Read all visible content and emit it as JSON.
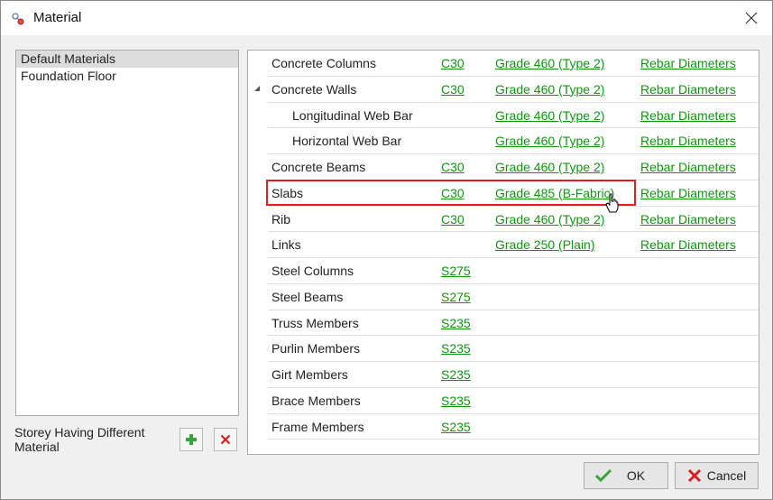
{
  "window": {
    "title": "Material",
    "icon": "material-app-icon",
    "close_icon": "close-icon"
  },
  "storeys": {
    "items": [
      {
        "label": "Default Materials",
        "selected": true
      },
      {
        "label": "Foundation Floor",
        "selected": false
      }
    ],
    "different_label": "Storey Having Different Material",
    "add_icon": "plus-icon",
    "delete_icon": "delete-x-icon"
  },
  "materials": {
    "rows": [
      {
        "name": "Concrete Columns",
        "concrete": "C30",
        "grade": "Grade 460 (Type 2)",
        "rebar": "Rebar Diameters"
      },
      {
        "name": "Concrete Walls",
        "concrete": "C30",
        "grade": "Grade 460 (Type 2)",
        "rebar": "Rebar Diameters",
        "expanded": true
      },
      {
        "name": "Longitudinal Web Bar",
        "concrete": "",
        "grade": "Grade 460 (Type 2)",
        "rebar": "Rebar Diameters",
        "child": true
      },
      {
        "name": "Horizontal Web Bar",
        "concrete": "",
        "grade": "Grade 460 (Type 2)",
        "rebar": "Rebar Diameters",
        "child": true
      },
      {
        "name": "Concrete Beams",
        "concrete": "C30",
        "grade": "Grade 460 (Type 2)",
        "rebar": "Rebar Diameters"
      },
      {
        "name": "Slabs",
        "concrete": "C30",
        "grade": "Grade 485 (B-Fabric)",
        "rebar": "Rebar Diameters",
        "highlighted": true
      },
      {
        "name": "Rib",
        "concrete": "C30",
        "grade": "Grade 460 (Type 2)",
        "rebar": "Rebar Diameters"
      },
      {
        "name": "Links",
        "concrete": "",
        "grade": "Grade 250 (Plain)",
        "rebar": "Rebar Diameters"
      },
      {
        "name": "Steel Columns",
        "concrete": "S275",
        "grade": "",
        "rebar": ""
      },
      {
        "name": "Steel Beams",
        "concrete": "S275",
        "grade": "",
        "rebar": ""
      },
      {
        "name": "Truss Members",
        "concrete": "S235",
        "grade": "",
        "rebar": ""
      },
      {
        "name": "Purlin Members",
        "concrete": "S235",
        "grade": "",
        "rebar": ""
      },
      {
        "name": "Girt Members",
        "concrete": "S235",
        "grade": "",
        "rebar": ""
      },
      {
        "name": "Brace Members",
        "concrete": "S235",
        "grade": "",
        "rebar": ""
      },
      {
        "name": "Frame Members",
        "concrete": "S235",
        "grade": "",
        "rebar": ""
      }
    ],
    "highlight_color": "#e02020",
    "link_color": "#119611"
  },
  "buttons": {
    "ok": {
      "label": "OK",
      "icon": "checkmark-icon"
    },
    "cancel": {
      "label": "Cancel",
      "icon": "cancel-x-icon"
    }
  }
}
